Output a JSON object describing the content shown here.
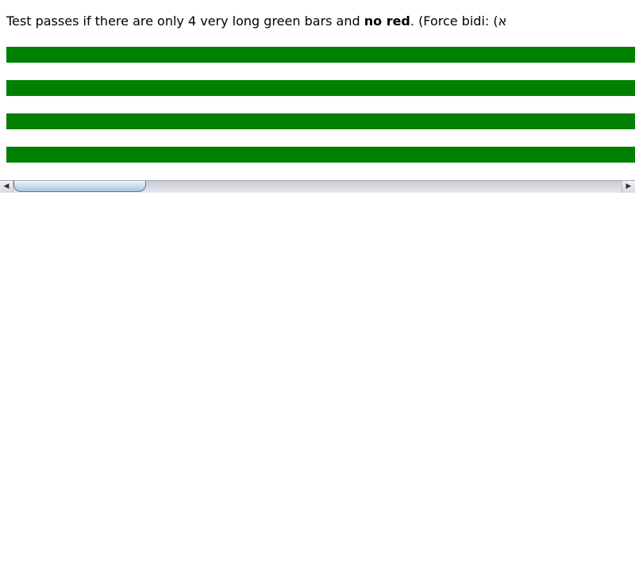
{
  "description": {
    "prefix": "Test passes if there are only 4 very long green bars and ",
    "bold": "no red",
    "suffix": ". (Force bidi: (א"
  },
  "bars": {
    "count": 4,
    "color": "#008000"
  },
  "scrollbar": {
    "left_arrow_icon": "triangle-left-icon",
    "right_arrow_icon": "triangle-right-icon",
    "thumb_position": 0.0
  }
}
